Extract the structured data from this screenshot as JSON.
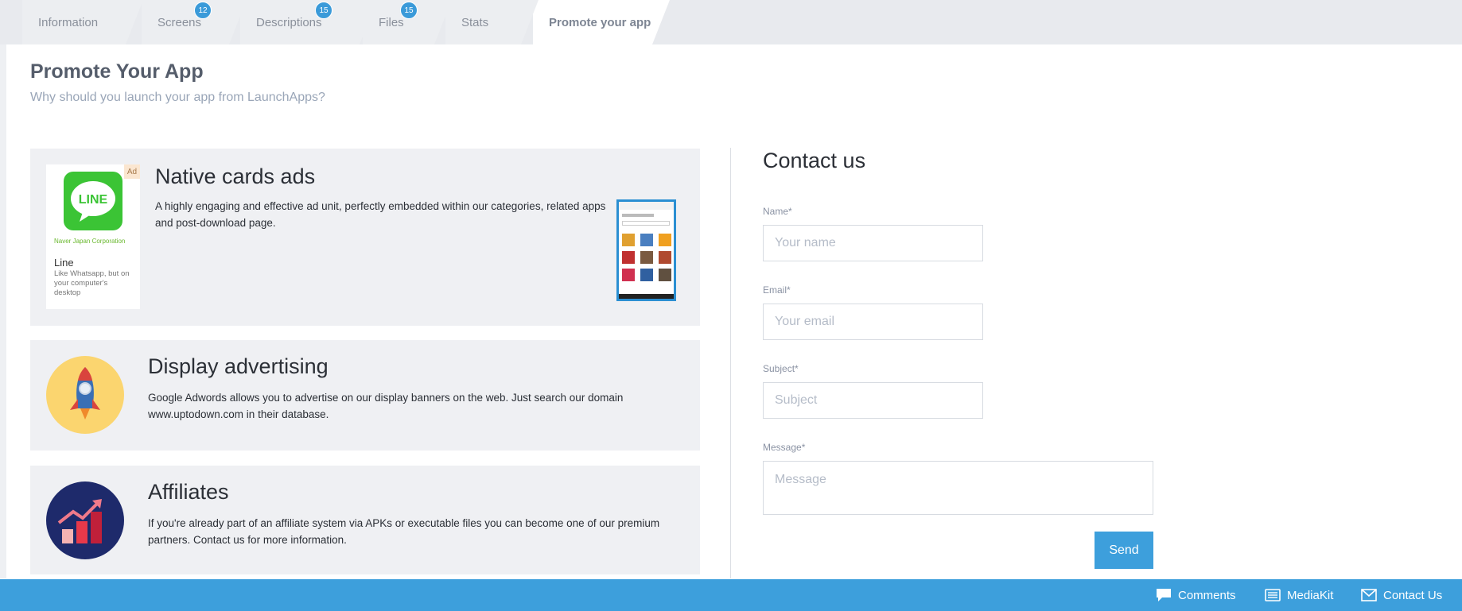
{
  "tabs": [
    {
      "label": "Information",
      "badge": ""
    },
    {
      "label": "Screens",
      "badge": "12"
    },
    {
      "label": "Descriptions",
      "badge": "15"
    },
    {
      "label": "Files",
      "badge": "15"
    },
    {
      "label": "Stats",
      "badge": ""
    },
    {
      "label": "Promote your app",
      "badge": "",
      "active": true
    }
  ],
  "page": {
    "title": "Promote Your App",
    "subtitle": "Why should you launch your app from LaunchApps?"
  },
  "cards": {
    "native": {
      "title": "Native cards ads",
      "text": "A highly engaging and effective ad unit, perfectly embedded within our categories, related apps and post-download page.",
      "ad": {
        "tag": "Ad",
        "logo_text": "LINE",
        "company": "Naver Japan Corporation",
        "name": "Line",
        "description": "Like Whatsapp, but on your computer's desktop"
      }
    },
    "display": {
      "title": "Display advertising",
      "text": "Google Adwords allows you to advertise on our display banners on the web. Just search our domain www.uptodown.com in their database.",
      "icon": "rocket-icon"
    },
    "affiliates": {
      "title": "Affiliates",
      "text": "If you're already part of an affiliate system via APKs or executable files you can become one of our premium partners. Contact us for more information.",
      "icon": "growth-chart-icon"
    }
  },
  "contact": {
    "title": "Contact us",
    "name_label": "Name*",
    "name_placeholder": "Your name",
    "email_label": "Email*",
    "email_placeholder": "Your email",
    "subject_label": "Subject*",
    "subject_placeholder": "Subject",
    "message_label": "Message*",
    "message_placeholder": "Message",
    "send_label": "Send"
  },
  "footer": {
    "comments": "Comments",
    "mediakit": "MediaKit",
    "contact": "Contact Us"
  },
  "colors": {
    "accent": "#3d9fdc",
    "badge": "#3a9ad9",
    "card_bg": "#eff0f3"
  }
}
